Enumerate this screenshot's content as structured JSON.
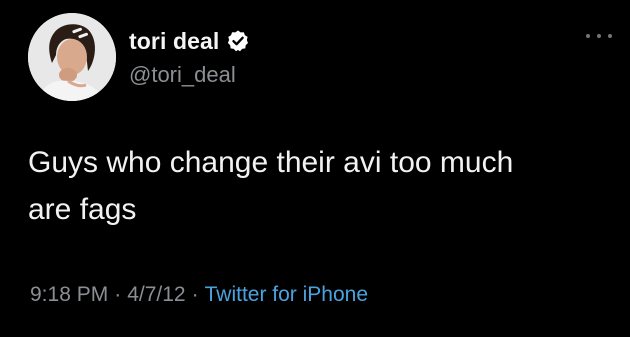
{
  "author": {
    "display_name": "tori deal",
    "handle": "@tori_deal",
    "verified": true,
    "avatar_icon": "profile-photo"
  },
  "tweet": {
    "text": "Guys who change their avi too much\nare fags",
    "time": "9:18 PM",
    "separator": "·",
    "date": "4/7/12",
    "source": "Twitter for iPhone"
  },
  "colors": {
    "background": "#000000",
    "text": "#f2f2f2",
    "secondary_text": "#8b8f93",
    "link": "#4aa3df",
    "verified_badge": "#ffffff"
  },
  "icons": {
    "verified": "verified-badge-icon",
    "more": "more-options-icon"
  }
}
